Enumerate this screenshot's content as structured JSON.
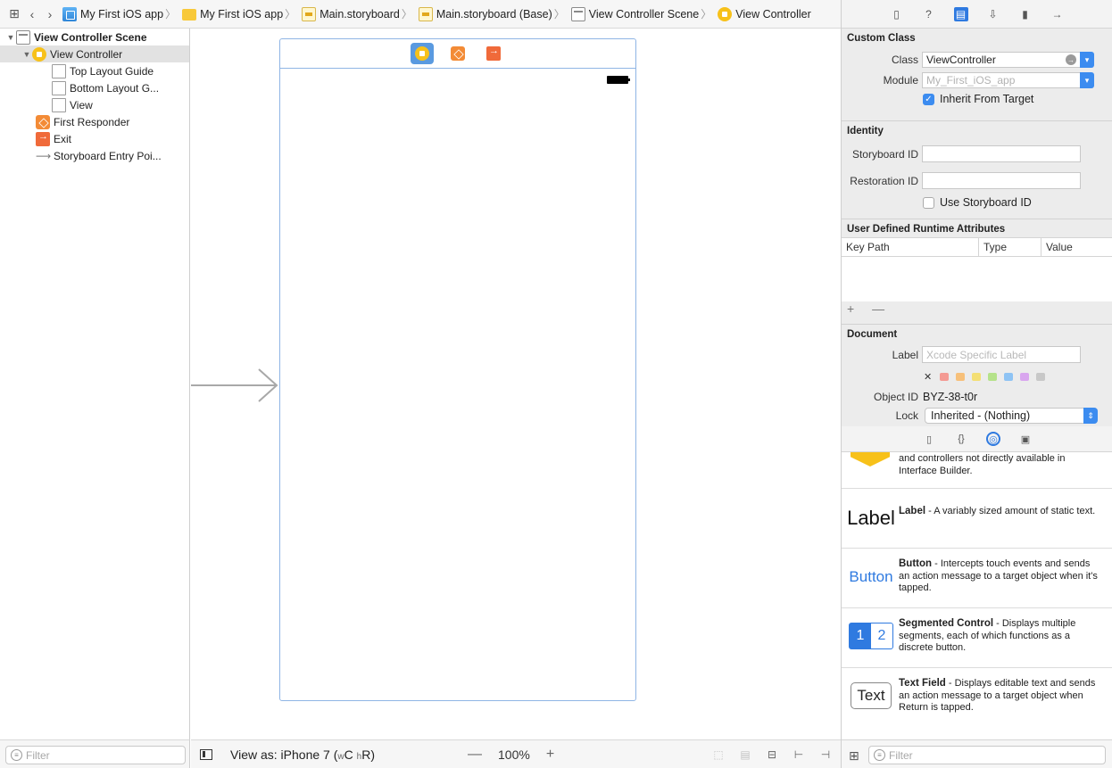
{
  "jumpbar": {
    "crumbs": [
      {
        "label": "My First iOS app",
        "icon": "app-project-icon"
      },
      {
        "label": "My First iOS app",
        "icon": "folder-icon"
      },
      {
        "label": "Main.storyboard",
        "icon": "storyboard-icon"
      },
      {
        "label": "Main.storyboard (Base)",
        "icon": "storyboard-icon"
      },
      {
        "label": "View Controller Scene",
        "icon": "scene-icon"
      },
      {
        "label": "View Controller",
        "icon": "view-controller-icon"
      }
    ]
  },
  "outline": {
    "items": [
      {
        "label": "View Controller Scene"
      },
      {
        "label": "View Controller"
      },
      {
        "label": "Top Layout Guide"
      },
      {
        "label": "Bottom Layout G..."
      },
      {
        "label": "View"
      },
      {
        "label": "First Responder"
      },
      {
        "label": "Exit"
      },
      {
        "label": "Storyboard Entry Poi..."
      }
    ],
    "filter_placeholder": "Filter"
  },
  "bottombar": {
    "view_as_prefix": "View as: iPhone 7 (",
    "w_small": "w",
    "w_big": "C",
    "h_small": "h",
    "h_big": "R",
    "view_as_suffix": ")",
    "zoom_minus": "—",
    "zoom_level": "100%",
    "zoom_plus": "+"
  },
  "inspector": {
    "custom_class": {
      "title": "Custom Class",
      "class_label": "Class",
      "class_value": "ViewController",
      "module_label": "Module",
      "module_placeholder": "My_First_iOS_app",
      "inherit_label": "Inherit From Target",
      "inherit_checked": true
    },
    "identity": {
      "title": "Identity",
      "storyboard_id_label": "Storyboard ID",
      "storyboard_id_value": "",
      "restoration_id_label": "Restoration ID",
      "restoration_id_value": "",
      "use_storyboard_id_label": "Use Storyboard ID",
      "use_storyboard_id_checked": false
    },
    "udra": {
      "title": "User Defined Runtime Attributes",
      "col_keypath": "Key Path",
      "col_type": "Type",
      "col_value": "Value",
      "add_remove": "+ —"
    },
    "document": {
      "title": "Document",
      "label_label": "Label",
      "label_placeholder": "Xcode Specific Label",
      "swatch_colors": [
        "#f49a93",
        "#f7c07a",
        "#f4df74",
        "#b5e28a",
        "#8ec3f4",
        "#d9a6ef",
        "#c8c8c8"
      ],
      "object_id_label": "Object ID",
      "object_id_value": "BYZ-38-t0r",
      "lock_label": "Lock",
      "lock_value": "Inherited - (Nothing)"
    }
  },
  "library": {
    "items": [
      {
        "thumb": "",
        "name": "",
        "desc": "and controllers not directly available in Interface Builder."
      },
      {
        "thumb": "Label",
        "name": "Label",
        "desc": " - A variably sized amount of static text."
      },
      {
        "thumb": "Button",
        "name": "Button",
        "desc": " - Intercepts touch events and sends an action message to a target object when it's tapped."
      },
      {
        "thumb": "",
        "name": "Segmented Control",
        "desc": " - Displays multiple segments, each of which functions as a discrete button."
      },
      {
        "thumb": "Text",
        "name": "Text Field",
        "desc": " - Displays editable text and sends an action message to a target object when Return is tapped."
      }
    ],
    "segment_1": "1",
    "segment_2": "2",
    "filter_placeholder": "Filter"
  },
  "colors": {
    "accent": "#2f7ae0",
    "vc_yellow": "#f7c11a",
    "frame_border": "#8fb5e5"
  }
}
